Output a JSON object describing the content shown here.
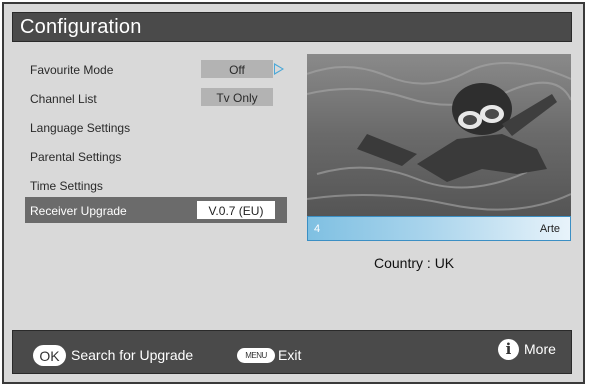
{
  "header": {
    "title": "Configuration"
  },
  "menu": {
    "items": [
      {
        "label": "Favourite Mode",
        "value": "Off",
        "has_arrow": true
      },
      {
        "label": "Channel List",
        "value": "Tv Only"
      },
      {
        "label": "Language Settings"
      },
      {
        "label": "Parental Settings"
      },
      {
        "label": "Time Settings"
      },
      {
        "label": "Receiver Upgrade",
        "value": "V.0.7 (EU)",
        "selected": true
      }
    ]
  },
  "preview": {
    "channel_number": "4",
    "channel_name": "Arte",
    "country_label": "Country : UK"
  },
  "footer": {
    "ok_key": "OK",
    "ok_action": "Search for Upgrade",
    "menu_key": "MENU",
    "menu_action": "Exit",
    "info_action": "More"
  },
  "colors": {
    "panel_bg": "#d9d9d9",
    "bar_bg": "#4a4a4a",
    "selected_row": "#6b6b6b",
    "channel_bar_accent": "#7fc0e2",
    "arrow": "#4aa8d8"
  }
}
